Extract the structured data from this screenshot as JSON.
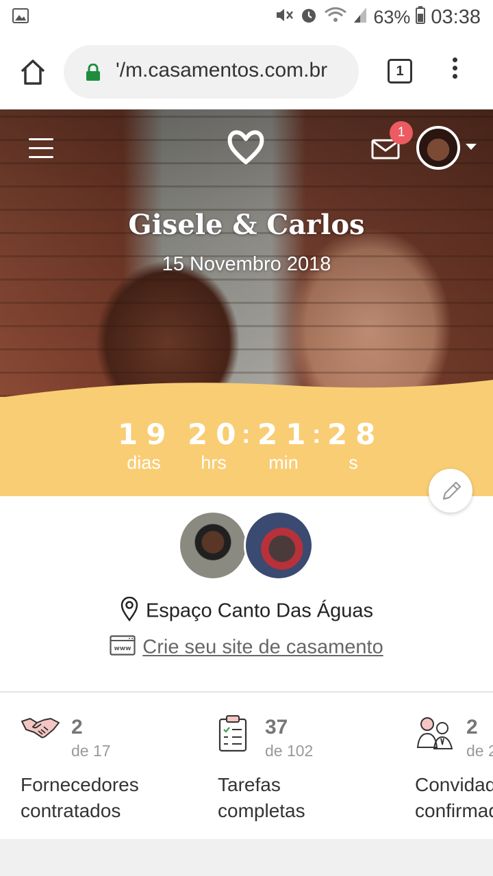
{
  "status_bar": {
    "battery": "63%",
    "time": "03:38"
  },
  "browser": {
    "url": "'/m.casamentos.com.br",
    "tab_count": "1"
  },
  "header": {
    "notification_count": "1"
  },
  "wedding": {
    "names": "Gisele & Carlos",
    "date": "15 Novembro 2018"
  },
  "countdown": [
    {
      "value": "19",
      "label": "dias"
    },
    {
      "value": "20",
      "label": "hrs"
    },
    {
      "value": "21",
      "label": "min"
    },
    {
      "value": "28",
      "label": "s"
    }
  ],
  "venue": {
    "name": "Espaço Canto Das Águas"
  },
  "site_link": {
    "label": "Crie seu site de casamento"
  },
  "stats": [
    {
      "icon": "handshake-icon",
      "count": "2",
      "total": "de 17",
      "title": "Fornecedores\ncontratados"
    },
    {
      "icon": "checklist-icon",
      "count": "37",
      "total": "de 102",
      "title": "Tarefas\ncompletas"
    },
    {
      "icon": "guests-icon",
      "count": "2",
      "total": "de 2",
      "title": "Convidados\nconfirmados"
    }
  ],
  "colors": {
    "countdown_bg": "#f9cd74",
    "badge": "#ec5b62",
    "lock": "#1e8e3e"
  }
}
